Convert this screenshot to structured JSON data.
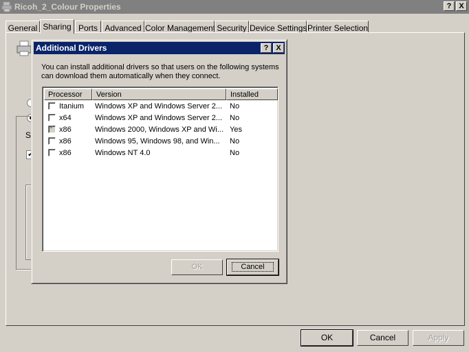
{
  "window": {
    "title": "Ricoh_2_Colour Properties",
    "help_glyph": "?",
    "close_glyph": "X",
    "icon": "printer-icon",
    "tabs": [
      {
        "label": "General"
      },
      {
        "label": "Sharing"
      },
      {
        "label": "Ports"
      },
      {
        "label": "Advanced"
      },
      {
        "label": "Color Management"
      },
      {
        "label": "Security"
      },
      {
        "label": "Device Settings"
      },
      {
        "label": "Printer Selection"
      }
    ],
    "active_tab": "Sharing",
    "background_fragments": {
      "s_label": "S|"
    },
    "buttons": {
      "ok": "OK",
      "cancel": "Cancel",
      "apply": "Apply"
    }
  },
  "dialog": {
    "title": "Additional Drivers",
    "help_glyph": "?",
    "close_glyph": "X",
    "description": "You can install additional drivers so that users on the following systems can download them automatically when they connect.",
    "columns": {
      "processor": "Processor",
      "version": "Version",
      "installed": "Installed"
    },
    "rows": [
      {
        "processor": "Itanium",
        "version": "Windows XP and Windows Server 2...",
        "installed": "No",
        "checked": false
      },
      {
        "processor": "x64",
        "version": "Windows XP and Windows Server 2...",
        "installed": "No",
        "checked": false
      },
      {
        "processor": "x86",
        "version": "Windows 2000, Windows XP and Wi...",
        "installed": "Yes",
        "checked": true
      },
      {
        "processor": "x86",
        "version": "Windows 95, Windows 98, and Win...",
        "installed": "No",
        "checked": false
      },
      {
        "processor": "x86",
        "version": "Windows NT 4.0",
        "installed": "No",
        "checked": false
      }
    ],
    "buttons": {
      "ok": "OK",
      "cancel": "Cancel"
    }
  }
}
